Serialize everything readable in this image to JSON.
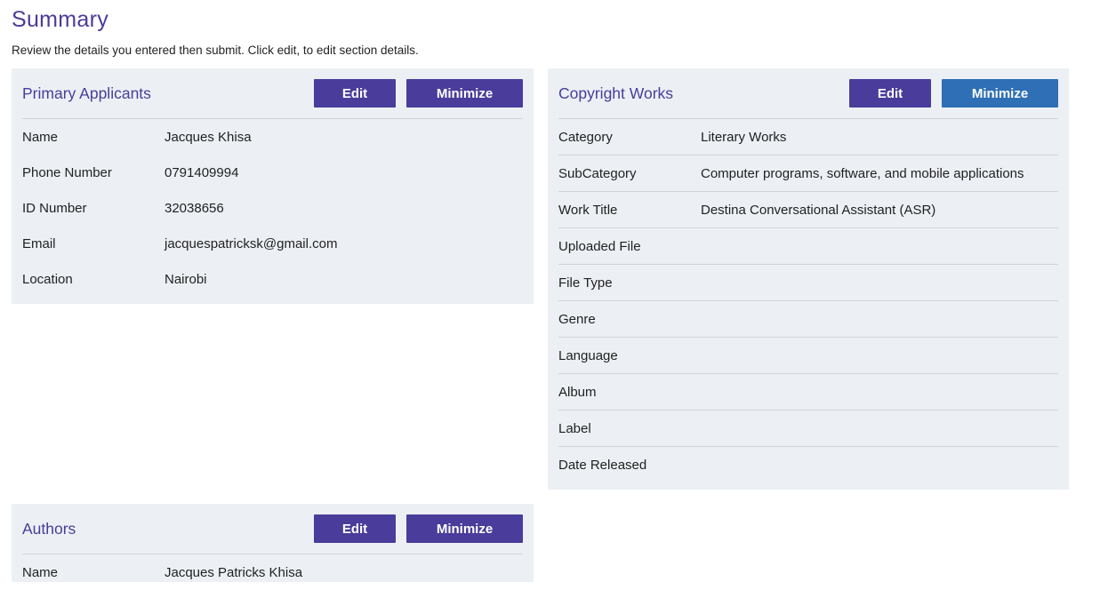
{
  "page": {
    "title": "Summary",
    "subtitle": "Review the details you entered then submit. Click edit, to edit section details."
  },
  "buttons": {
    "edit": "Edit",
    "minimize": "Minimize"
  },
  "primary_applicants": {
    "title": "Primary Applicants",
    "rows": [
      {
        "label": "Name",
        "value": "Jacques Khisa"
      },
      {
        "label": "Phone Number",
        "value": "0791409994"
      },
      {
        "label": "ID Number",
        "value": "32038656"
      },
      {
        "label": "Email",
        "value": "jacquespatricksk@gmail.com"
      },
      {
        "label": "Location",
        "value": "Nairobi"
      }
    ]
  },
  "copyright_works": {
    "title": "Copyright Works",
    "rows": [
      {
        "label": "Category",
        "value": "Literary Works"
      },
      {
        "label": "SubCategory",
        "value": "Computer programs, software, and mobile applications"
      },
      {
        "label": "Work Title",
        "value": "Destina Conversational Assistant (ASR)"
      },
      {
        "label": "Uploaded File",
        "value": ""
      },
      {
        "label": "File Type",
        "value": ""
      },
      {
        "label": "Genre",
        "value": ""
      },
      {
        "label": "Language",
        "value": ""
      },
      {
        "label": "Album",
        "value": ""
      },
      {
        "label": "Label",
        "value": ""
      },
      {
        "label": "Date Released",
        "value": ""
      }
    ]
  },
  "authors": {
    "title": "Authors",
    "rows": [
      {
        "label": "Name",
        "value": "Jacques Patricks Khisa"
      }
    ]
  },
  "colors": {
    "accent": "#4a3c9a",
    "minimize_active": "#2e6fb5",
    "card_bg": "#ecf0f5"
  }
}
